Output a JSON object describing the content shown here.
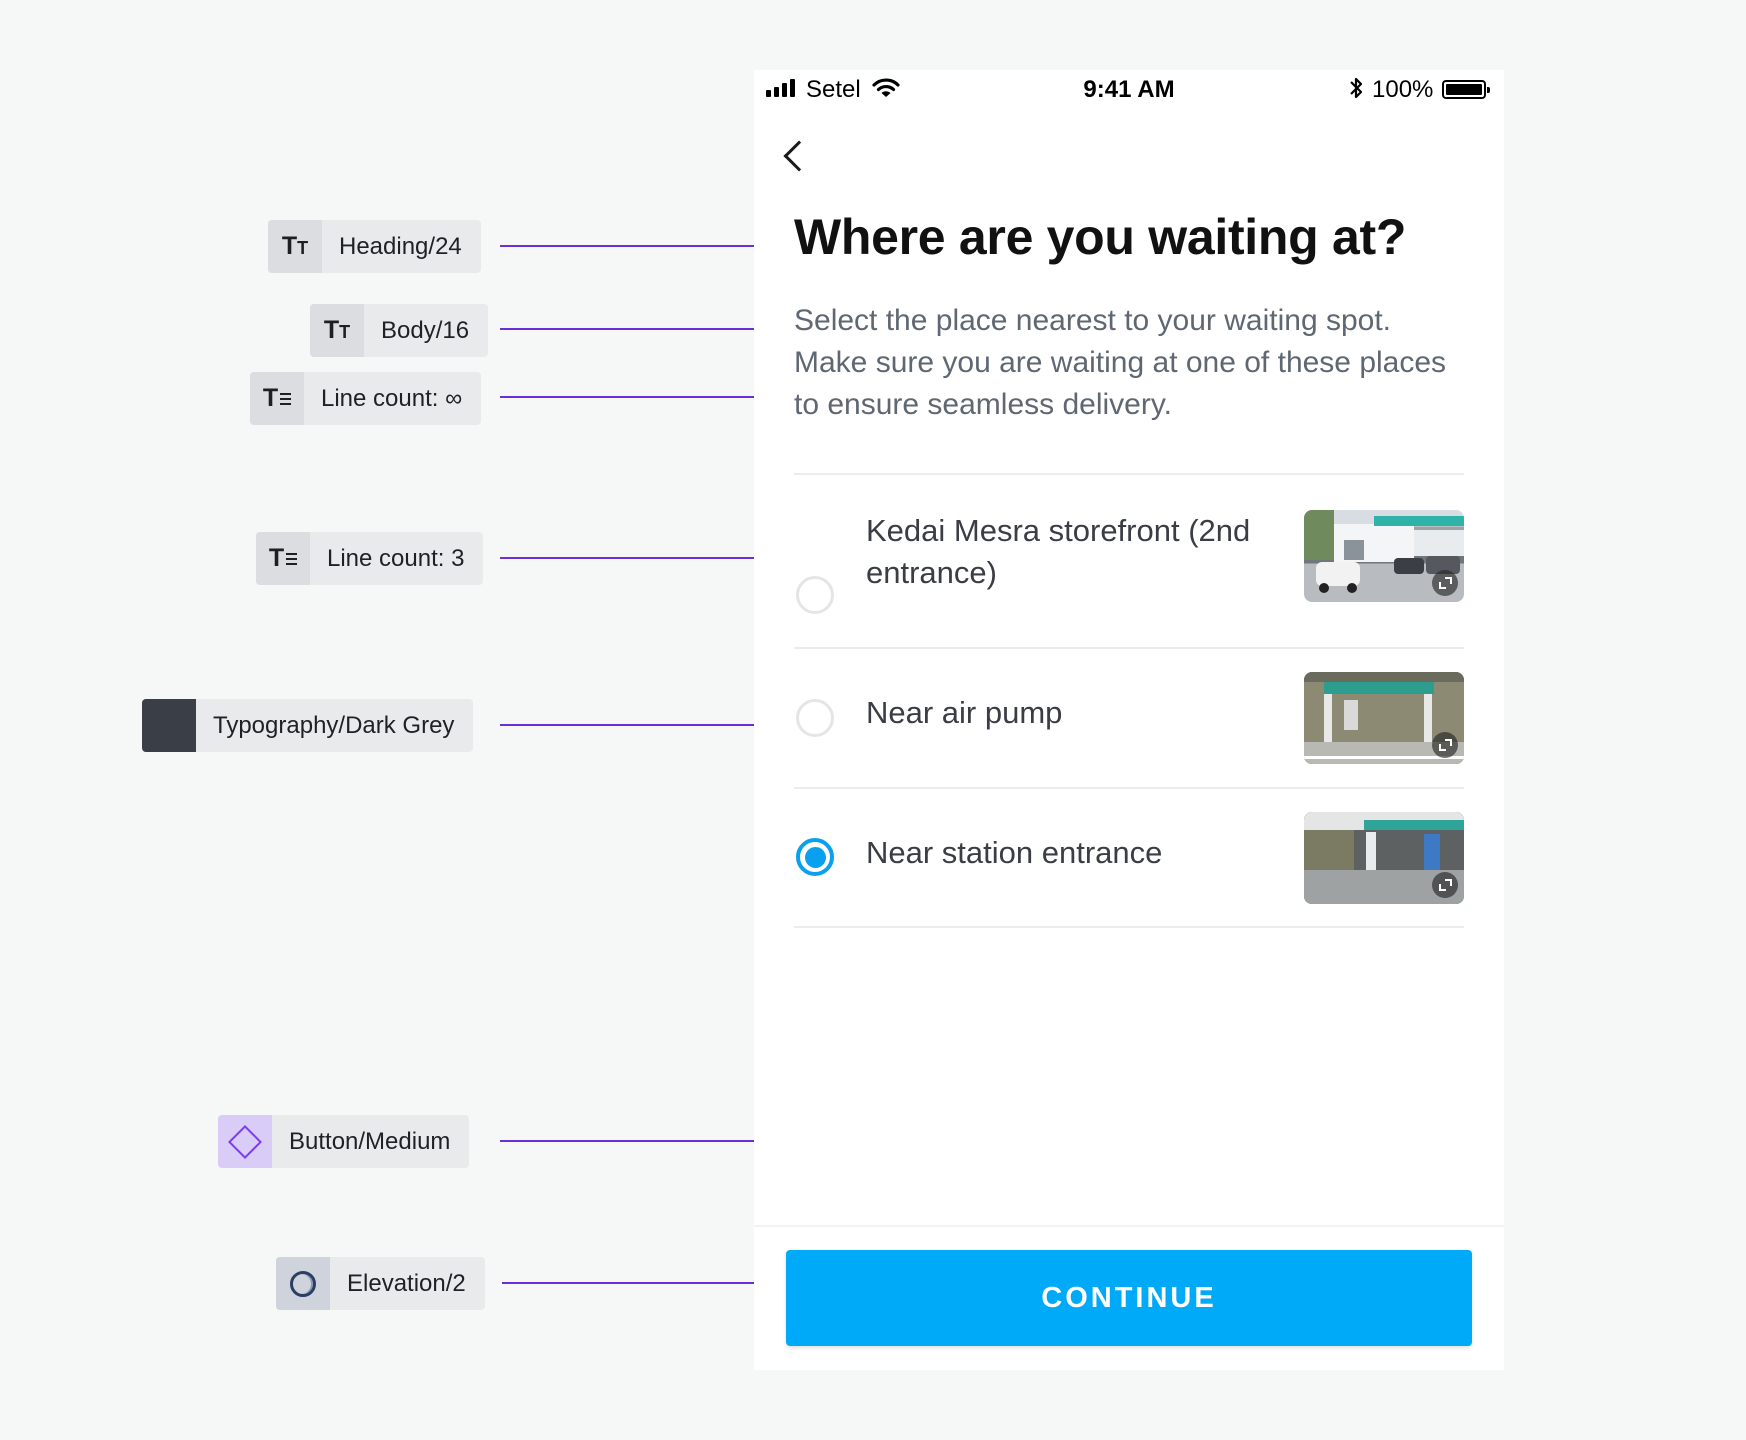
{
  "annotations": {
    "heading": {
      "icon": "text-style-icon",
      "label": "Heading/24"
    },
    "body": {
      "icon": "text-style-icon",
      "label": "Body/16"
    },
    "line_count_inf": {
      "icon": "line-count-icon",
      "label": "Line count: ∞"
    },
    "line_count_3": {
      "icon": "line-count-icon",
      "label": "Line count: 3"
    },
    "color": {
      "icon": "color-swatch-icon",
      "label": "Typography/Dark Grey",
      "swatch": "#3a3e47"
    },
    "button": {
      "icon": "component-diamond-icon",
      "label": "Button/Medium"
    },
    "elevation": {
      "icon": "elevation-icon",
      "label": "Elevation/2"
    },
    "connector_color": "#6b2fd8"
  },
  "status_bar": {
    "carrier": "Setel",
    "time": "9:41 AM",
    "battery": "100%",
    "icons": [
      "signal-icon",
      "wifi-icon",
      "bluetooth-icon",
      "battery-icon"
    ]
  },
  "screen": {
    "back_icon": "chevron-left-icon",
    "title": "Where are you waiting at?",
    "description": "Select the place nearest to your waiting spot. Make sure you are waiting at one of these places to ensure seamless delivery.",
    "options": [
      {
        "label": "Kedai Mesra storefront (2nd entrance)",
        "selected": false,
        "thumbnail": "storefront-photo"
      },
      {
        "label": "Near air pump",
        "selected": false,
        "thumbnail": "air-pump-photo"
      },
      {
        "label": "Near station entrance",
        "selected": true,
        "thumbnail": "station-entrance-photo"
      }
    ],
    "continue_label": "CONTINUE"
  },
  "colors": {
    "accent": "#00aaf8",
    "radio_selected": "#0aa0f0",
    "body_text": "#5f6772",
    "heading_text": "#111111"
  }
}
